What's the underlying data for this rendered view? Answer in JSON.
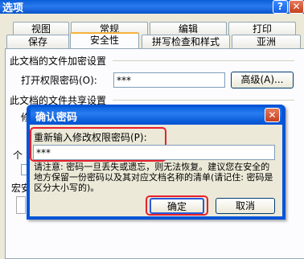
{
  "window": {
    "title": "选项",
    "help_icon": "?",
    "close_icon": "✕"
  },
  "tabs_row1": [
    "视图",
    "常规",
    "编辑",
    "打印"
  ],
  "tabs_row2": [
    "保存",
    "安全性",
    "拼写检查和样式",
    "亚洲"
  ],
  "active_tab": "安全性",
  "encrypt_group": {
    "title": "此文档的文件加密设置",
    "open_password_label": "打开权限密码(O):",
    "open_password_value": "***",
    "advanced_button": "高级(A)..."
  },
  "share_group": {
    "title": "此文档的文件共享设置",
    "partial_label": "修",
    "partial_row2": "个",
    "partial_row3": "宏安"
  },
  "confirm_dialog": {
    "title": "确认密码",
    "close_icon": "✕",
    "prompt": "重新输入修改权限密码(P):",
    "password_value": "***",
    "note": "请注意: 密码一旦丢失或遗忘，则无法恢复。建议您在安全的地方保留一份密码以及其对应文档名称的清单(请记住: 密码是区分大小写的)。",
    "ok_button": "确定",
    "cancel_button": "取消"
  },
  "colors": {
    "highlight": "#e8202c",
    "titlebar": "#0454d6",
    "tab_accent": "#f7b23d"
  }
}
